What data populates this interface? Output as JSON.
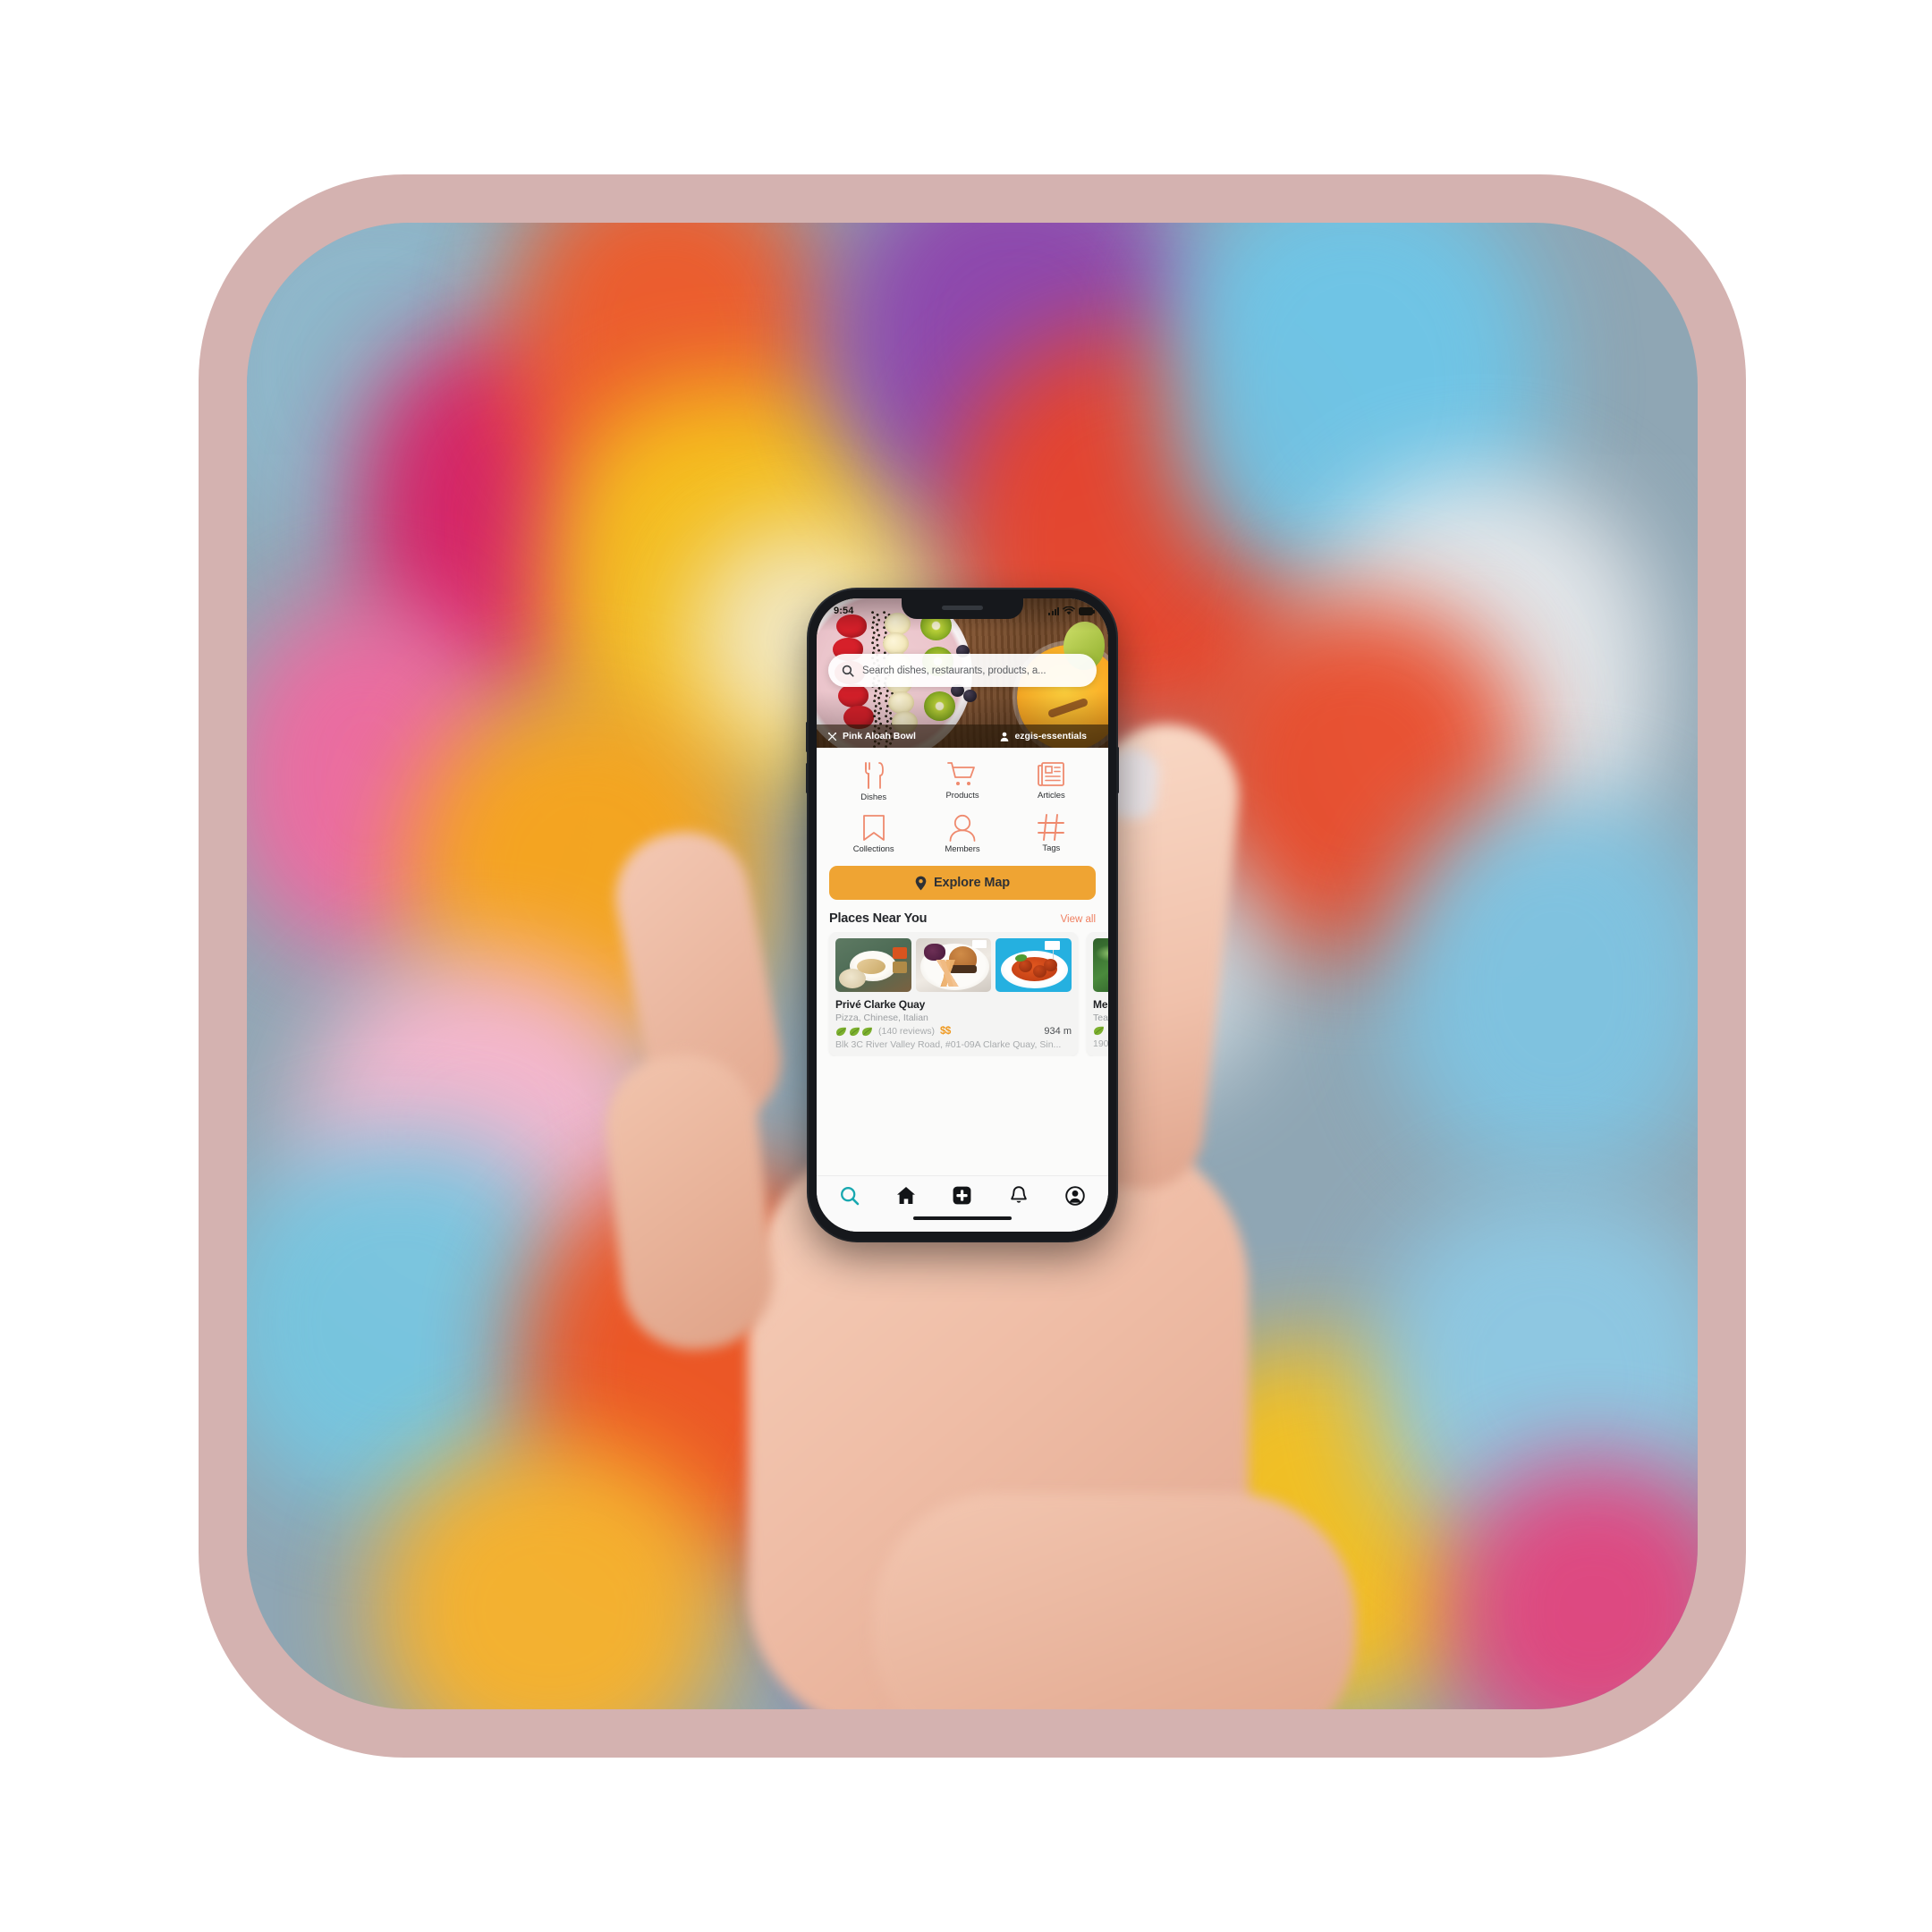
{
  "app": {
    "status_bar": {
      "time": "9:54",
      "signal_icon": "cellular-signal-icon",
      "wifi_icon": "wifi-icon",
      "battery_icon": "battery-icon"
    },
    "search": {
      "placeholder": "Search dishes, restaurants, products, a...",
      "icon": "search-icon"
    },
    "hero": {
      "dish_name": "Pink Aloah Bowl",
      "dish_icon": "cutlery-icon",
      "author": "ezgis-essentials",
      "author_icon": "person-icon"
    },
    "categories": [
      {
        "label": "Dishes",
        "icon": "cutlery-icon"
      },
      {
        "label": "Products",
        "icon": "shopping-cart-icon"
      },
      {
        "label": "Articles",
        "icon": "newspaper-icon"
      },
      {
        "label": "Collections",
        "icon": "bookmark-icon"
      },
      {
        "label": "Members",
        "icon": "person-icon"
      },
      {
        "label": "Tags",
        "icon": "hashtag-icon"
      }
    ],
    "explore": {
      "label": "Explore Map",
      "icon": "map-pin-icon",
      "color": "#efa433"
    },
    "section": {
      "title": "Places Near You",
      "view_all": "View all",
      "view_all_color": "#ef7f60"
    },
    "places": [
      {
        "name": "Privé Clarke Quay",
        "cuisines": "Pizza, Chinese, Italian",
        "leaf_rating": 3,
        "reviews": "(140 reviews)",
        "price": "$$",
        "distance": "934 m",
        "address": "Blk 3C River Valley Road, #01-09A Clarke Quay, Sin..."
      },
      {
        "name": "Me",
        "cuisines": "Tea",
        "leaf_rating": 1,
        "distance": "190"
      }
    ],
    "tabs": [
      {
        "name": "search",
        "icon": "search-icon",
        "active": true
      },
      {
        "name": "home",
        "icon": "home-icon",
        "active": false
      },
      {
        "name": "add",
        "icon": "plus-square-icon",
        "active": false
      },
      {
        "name": "notifications",
        "icon": "bell-icon",
        "active": false
      },
      {
        "name": "profile",
        "icon": "account-icon",
        "active": false
      }
    ],
    "colors": {
      "accent_coral": "#ef7f60",
      "accent_amber": "#efa433",
      "active_tab_teal": "#19a8b0",
      "leaf_green": "#74a82e",
      "frame_pink": "#d4b2b0"
    }
  }
}
